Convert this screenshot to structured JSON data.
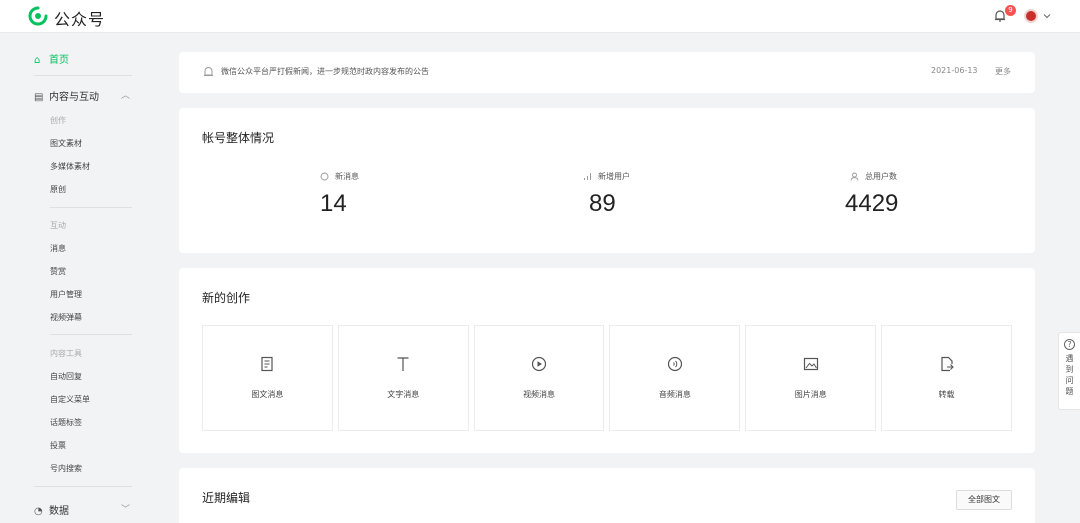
{
  "app": {
    "name": "公众号"
  },
  "header": {
    "notification_count": "9"
  },
  "sidebar": {
    "home": "首页",
    "content_group": "内容与互动",
    "create_title": "创作",
    "create_items": [
      "图文素材",
      "多媒体素材",
      "原创"
    ],
    "interact_title": "互动",
    "interact_items": [
      "消息",
      "赞赏",
      "用户管理",
      "视频弹幕"
    ],
    "tools_title": "内容工具",
    "tools_items": [
      "自动回复",
      "自定义菜单",
      "话题标签",
      "投票",
      "号内搜索"
    ],
    "data_group": "数据"
  },
  "notice": {
    "text": "微信公众平台严打假新闻，进一步规范时政内容发布的公告",
    "date": "2021-06-13",
    "more": "更多"
  },
  "overview": {
    "title": "帐号整体情况",
    "stats": [
      {
        "label": "新消息",
        "value": "14",
        "icon": "message-icon"
      },
      {
        "label": "新增用户",
        "value": "89",
        "icon": "bar-chart-icon"
      },
      {
        "label": "总用户数",
        "value": "4429",
        "icon": "user-icon"
      }
    ]
  },
  "create": {
    "title": "新的创作",
    "items": [
      {
        "label": "图文消息",
        "icon": "document-icon"
      },
      {
        "label": "文字消息",
        "icon": "text-icon"
      },
      {
        "label": "视频消息",
        "icon": "video-icon"
      },
      {
        "label": "音频消息",
        "icon": "audio-icon"
      },
      {
        "label": "图片消息",
        "icon": "image-icon"
      },
      {
        "label": "转载",
        "icon": "repost-icon"
      }
    ]
  },
  "recent": {
    "title": "近期编辑",
    "all_button": "全部图文"
  },
  "help": {
    "label": "遇到问题"
  },
  "colors": {
    "brand": "#07c160",
    "badge": "#fa5151"
  }
}
